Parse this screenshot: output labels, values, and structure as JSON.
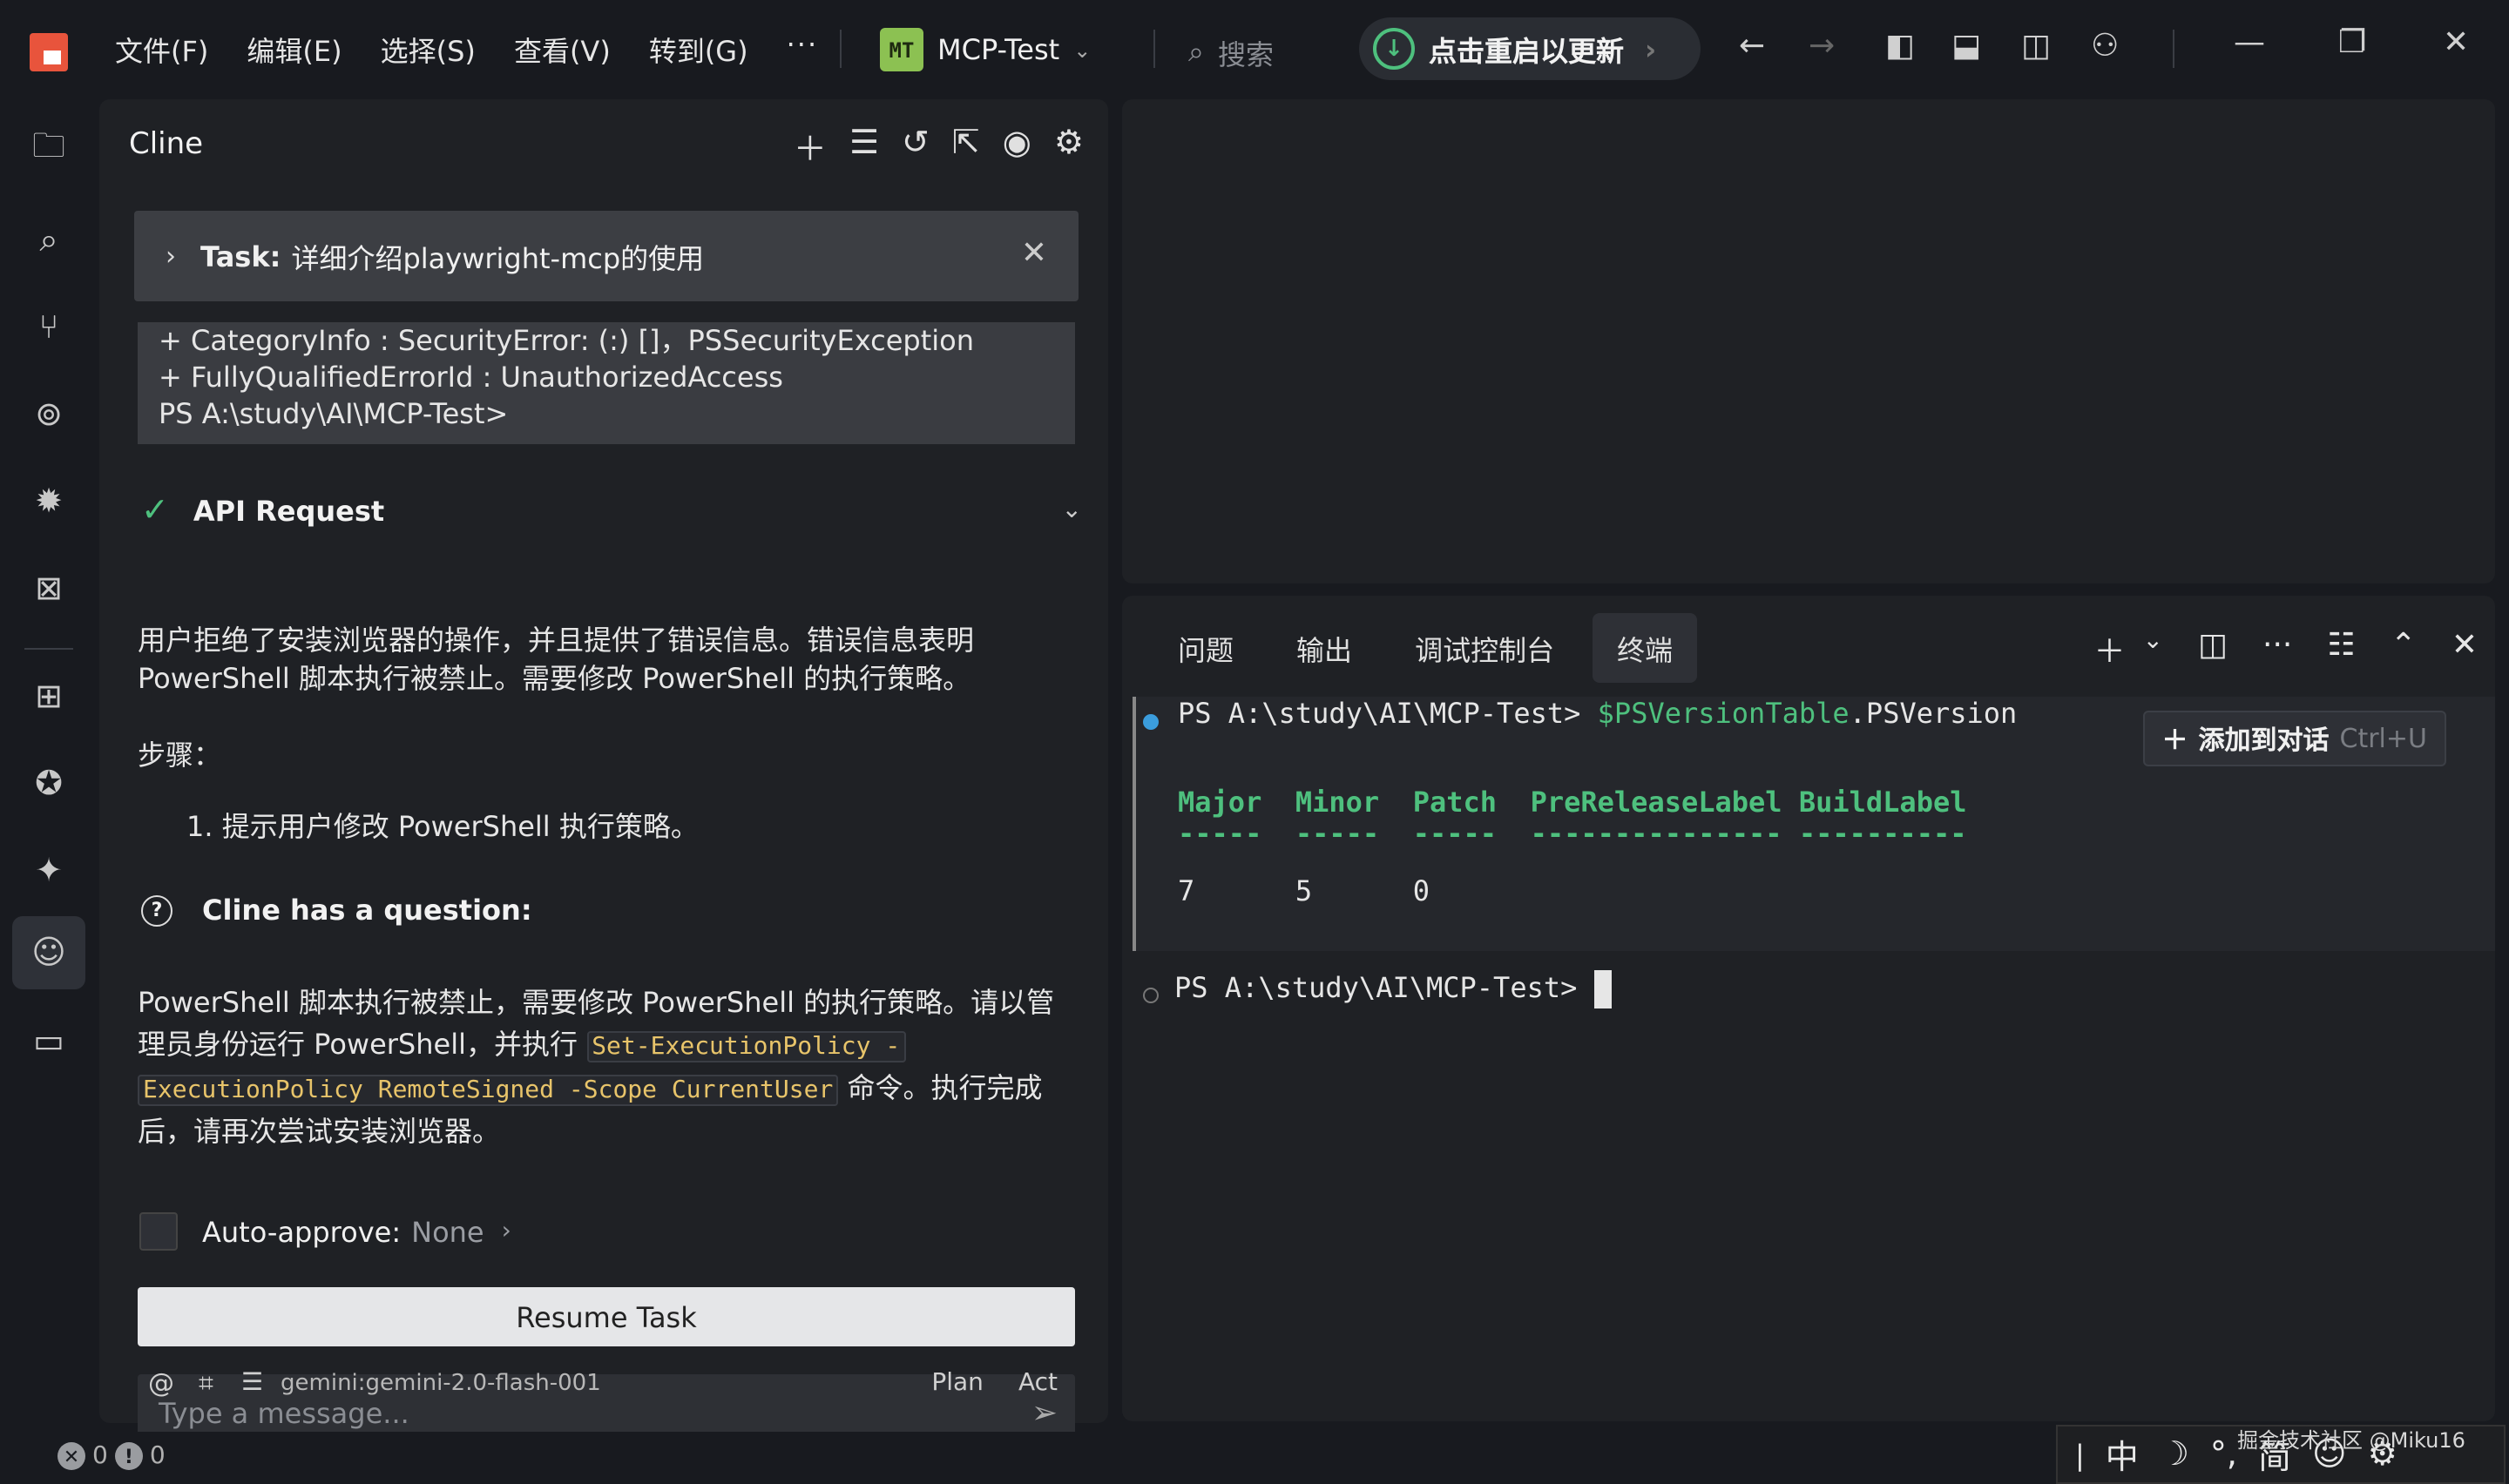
{
  "titlebar": {
    "menu": [
      "文件(F)",
      "编辑(E)",
      "选择(S)",
      "查看(V)",
      "转到(G)",
      "···"
    ],
    "project_badge": "MT",
    "project_name": "MCP-Test",
    "search_placeholder": "搜索",
    "update_label": "点击重启以更新"
  },
  "cline": {
    "title": "Cline",
    "task_label": "Task:",
    "task_text": "详细介绍playwright-mcp的使用",
    "output_lines": [
      "+ CategoryInfo : SecurityError: (:) []，PSSecurityException",
      "+ FullyQualifiedErrorId : UnauthorizedAccess",
      "PS A:\\study\\AI\\MCP-Test>"
    ],
    "api_request_label": "API Request",
    "para1": "用户拒绝了安装浏览器的操作，并且提供了错误信息。错误信息表明 PowerShell 脚本执行被禁止。需要修改 PowerShell 的执行策略。",
    "steps_label": "步骤：",
    "step1": "1. 提示用户修改 PowerShell 执行策略。",
    "question_label": "Cline has a question:",
    "q_text_before": "PowerShell 脚本执行被禁止，需要修改 PowerShell 的执行策略。请以管理员身份运行 PowerShell，并执行 ",
    "q_code_1": "Set-ExecutionPolicy -",
    "q_code_2": "ExecutionPolicy RemoteSigned -Scope CurrentUser",
    "q_text_after": " 命令。执行完成后，请再次尝试安装浏览器。",
    "auto_approve_label": "Auto-approve:",
    "auto_approve_value": "None",
    "resume_label": "Resume Task",
    "message_placeholder": "Type a message...",
    "model": "gemini:gemini-2.0-flash-001",
    "plan_label": "Plan",
    "act_label": "Act"
  },
  "terminal": {
    "tabs": [
      "问题",
      "输出",
      "调试控制台",
      "终端"
    ],
    "active_tab": "终端",
    "prompt1": "PS A:\\study\\AI\\MCP-Test> ",
    "cmd_var": "$PSVersionTable",
    "cmd_prop": ".PSVersion",
    "header": "Major  Minor  Patch  PreReleaseLabel BuildLabel",
    "rule": "-----  -----  -----  --------------- ----------",
    "values": "7      5      0",
    "prompt2": "PS A:\\study\\AI\\MCP-Test> ",
    "add_chat_label": "添加到对话",
    "add_chat_shortcut": "Ctrl+U"
  },
  "status": {
    "errors": "0",
    "warnings": "0"
  },
  "ime": {
    "chars": [
      "中",
      "☽",
      "°,",
      "简",
      "☺",
      "⚙"
    ]
  },
  "watermark": "掘金技术社区 @Miku16",
  "colors": {
    "accent_green": "#4ec07e",
    "code_yellow": "#e8c46a",
    "badge_green": "#8cc152",
    "logo_red": "#e8543c"
  }
}
